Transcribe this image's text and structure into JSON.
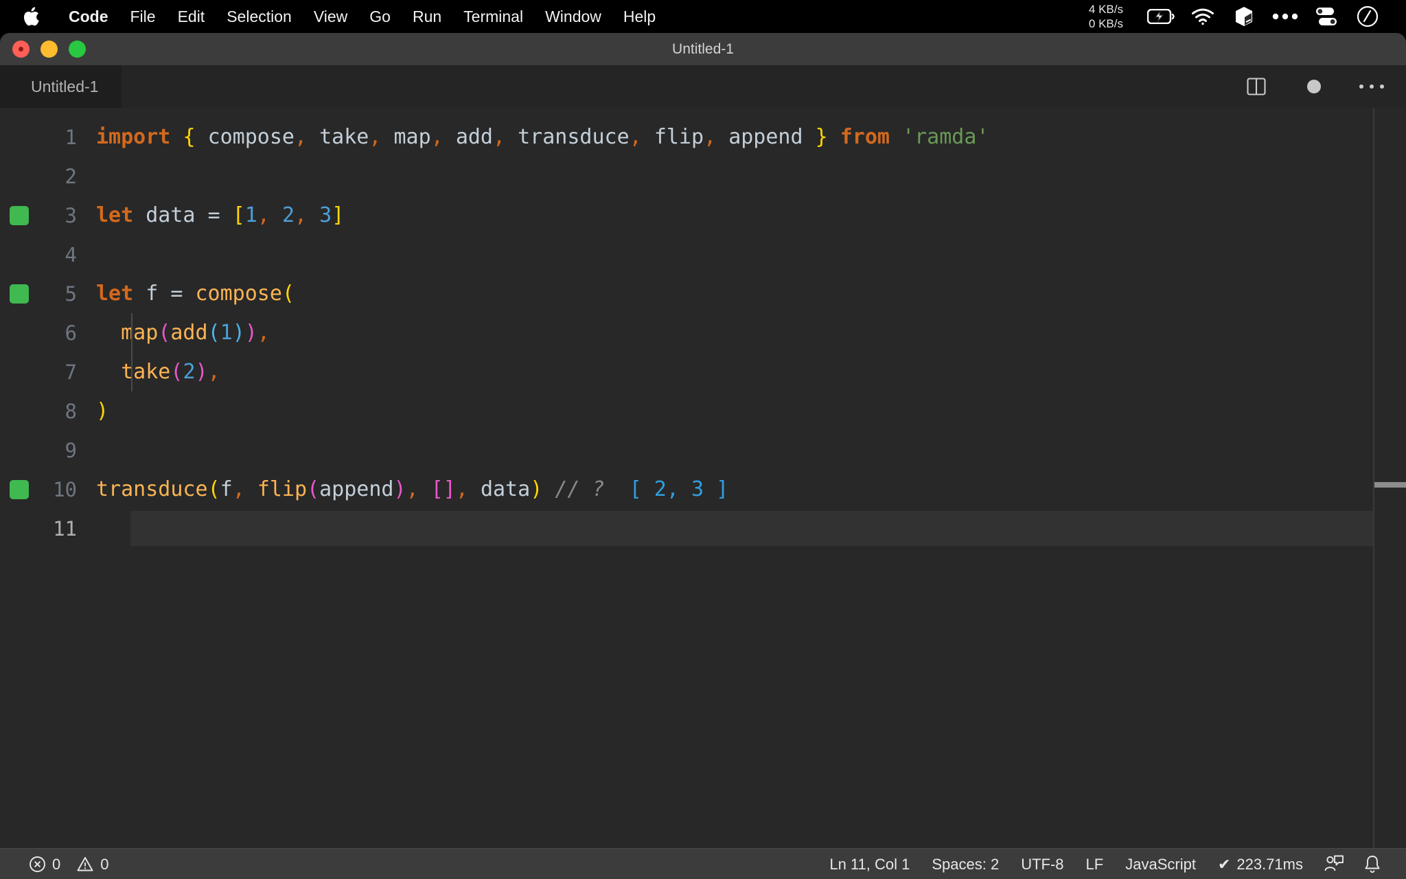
{
  "menubar": {
    "apple_icon": "apple-logo-icon",
    "items": [
      {
        "label": "Code",
        "bold": true
      },
      {
        "label": "File",
        "bold": false
      },
      {
        "label": "Edit",
        "bold": false
      },
      {
        "label": "Selection",
        "bold": false
      },
      {
        "label": "View",
        "bold": false
      },
      {
        "label": "Go",
        "bold": false
      },
      {
        "label": "Run",
        "bold": false
      },
      {
        "label": "Terminal",
        "bold": false
      },
      {
        "label": "Window",
        "bold": false
      },
      {
        "label": "Help",
        "bold": false
      }
    ],
    "network_down": "4 KB/s",
    "network_up": "0 KB/s",
    "tray_icons": [
      "battery-charging-icon",
      "wifi-icon",
      "cube-icon",
      "ellipsis-icon",
      "control-center-icon",
      "siri-clock-icon"
    ]
  },
  "window": {
    "title": "Untitled-1",
    "traffic_lights": [
      "close-button",
      "minimize-button",
      "maximize-button"
    ]
  },
  "tabs": {
    "active_tab": "Untitled-1",
    "actions": [
      "split-editor-icon",
      "unsaved-dot-icon",
      "more-actions-icon"
    ]
  },
  "editor": {
    "language": "JavaScript",
    "lines": [
      {
        "n": "1",
        "run_marker": false,
        "active": false,
        "tokens": [
          {
            "t": "import",
            "c": "t-kw"
          },
          {
            "t": " ",
            "c": "t-var"
          },
          {
            "t": "{",
            "c": "t-b1"
          },
          {
            "t": " ",
            "c": "t-var"
          },
          {
            "t": "compose",
            "c": "t-var"
          },
          {
            "t": ",",
            "c": "t-comma"
          },
          {
            "t": " ",
            "c": "t-var"
          },
          {
            "t": "take",
            "c": "t-var"
          },
          {
            "t": ",",
            "c": "t-comma"
          },
          {
            "t": " ",
            "c": "t-var"
          },
          {
            "t": "map",
            "c": "t-var"
          },
          {
            "t": ",",
            "c": "t-comma"
          },
          {
            "t": " ",
            "c": "t-var"
          },
          {
            "t": "add",
            "c": "t-var"
          },
          {
            "t": ",",
            "c": "t-comma"
          },
          {
            "t": " ",
            "c": "t-var"
          },
          {
            "t": "transduce",
            "c": "t-var"
          },
          {
            "t": ",",
            "c": "t-comma"
          },
          {
            "t": " ",
            "c": "t-var"
          },
          {
            "t": "flip",
            "c": "t-var"
          },
          {
            "t": ",",
            "c": "t-comma"
          },
          {
            "t": " ",
            "c": "t-var"
          },
          {
            "t": "append",
            "c": "t-var"
          },
          {
            "t": " ",
            "c": "t-var"
          },
          {
            "t": "}",
            "c": "t-b1"
          },
          {
            "t": " ",
            "c": "t-var"
          },
          {
            "t": "from",
            "c": "t-kw"
          },
          {
            "t": " ",
            "c": "t-var"
          },
          {
            "t": "'ramda'",
            "c": "t-str"
          }
        ]
      },
      {
        "n": "2",
        "run_marker": false,
        "active": false,
        "tokens": []
      },
      {
        "n": "3",
        "run_marker": true,
        "active": false,
        "tokens": [
          {
            "t": "let",
            "c": "t-kw"
          },
          {
            "t": " ",
            "c": "t-var"
          },
          {
            "t": "data",
            "c": "t-var"
          },
          {
            "t": " ",
            "c": "t-var"
          },
          {
            "t": "=",
            "c": "t-op"
          },
          {
            "t": " ",
            "c": "t-var"
          },
          {
            "t": "[",
            "c": "t-b1"
          },
          {
            "t": "1",
            "c": "t-num"
          },
          {
            "t": ",",
            "c": "t-comma"
          },
          {
            "t": " ",
            "c": "t-var"
          },
          {
            "t": "2",
            "c": "t-num"
          },
          {
            "t": ",",
            "c": "t-comma"
          },
          {
            "t": " ",
            "c": "t-var"
          },
          {
            "t": "3",
            "c": "t-num"
          },
          {
            "t": "]",
            "c": "t-b1"
          }
        ]
      },
      {
        "n": "4",
        "run_marker": false,
        "active": false,
        "tokens": []
      },
      {
        "n": "5",
        "run_marker": true,
        "active": false,
        "tokens": [
          {
            "t": "let",
            "c": "t-kw"
          },
          {
            "t": " ",
            "c": "t-var"
          },
          {
            "t": "f",
            "c": "t-var"
          },
          {
            "t": " ",
            "c": "t-var"
          },
          {
            "t": "=",
            "c": "t-op"
          },
          {
            "t": " ",
            "c": "t-var"
          },
          {
            "t": "compose",
            "c": "t-fn"
          },
          {
            "t": "(",
            "c": "t-b1"
          }
        ]
      },
      {
        "n": "6",
        "run_marker": false,
        "active": false,
        "tokens": [
          {
            "t": "  ",
            "c": "t-var"
          },
          {
            "t": "map",
            "c": "t-fn"
          },
          {
            "t": "(",
            "c": "t-b2"
          },
          {
            "t": "add",
            "c": "t-fn"
          },
          {
            "t": "(",
            "c": "t-b3"
          },
          {
            "t": "1",
            "c": "t-num"
          },
          {
            "t": ")",
            "c": "t-b3"
          },
          {
            "t": ")",
            "c": "t-b2"
          },
          {
            "t": ",",
            "c": "t-comma"
          }
        ]
      },
      {
        "n": "7",
        "run_marker": false,
        "active": false,
        "tokens": [
          {
            "t": "  ",
            "c": "t-var"
          },
          {
            "t": "take",
            "c": "t-fn"
          },
          {
            "t": "(",
            "c": "t-b2"
          },
          {
            "t": "2",
            "c": "t-num"
          },
          {
            "t": ")",
            "c": "t-b2"
          },
          {
            "t": ",",
            "c": "t-comma"
          }
        ]
      },
      {
        "n": "8",
        "run_marker": false,
        "active": false,
        "tokens": [
          {
            "t": ")",
            "c": "t-b1"
          }
        ]
      },
      {
        "n": "9",
        "run_marker": false,
        "active": false,
        "tokens": []
      },
      {
        "n": "10",
        "run_marker": true,
        "active": false,
        "tokens": [
          {
            "t": "transduce",
            "c": "t-fn"
          },
          {
            "t": "(",
            "c": "t-b1"
          },
          {
            "t": "f",
            "c": "t-var"
          },
          {
            "t": ",",
            "c": "t-comma"
          },
          {
            "t": " ",
            "c": "t-var"
          },
          {
            "t": "flip",
            "c": "t-fn"
          },
          {
            "t": "(",
            "c": "t-b2"
          },
          {
            "t": "append",
            "c": "t-var"
          },
          {
            "t": ")",
            "c": "t-b2"
          },
          {
            "t": ",",
            "c": "t-comma"
          },
          {
            "t": " ",
            "c": "t-var"
          },
          {
            "t": "[",
            "c": "t-b2"
          },
          {
            "t": "]",
            "c": "t-b2"
          },
          {
            "t": ",",
            "c": "t-comma"
          },
          {
            "t": " ",
            "c": "t-var"
          },
          {
            "t": "data",
            "c": "t-var"
          },
          {
            "t": ")",
            "c": "t-b1"
          },
          {
            "t": " ",
            "c": "t-var"
          },
          {
            "t": "// ?",
            "c": "t-comment"
          },
          {
            "t": "  ",
            "c": "t-var"
          },
          {
            "t": "[ 2, 3 ]",
            "c": "t-result"
          }
        ]
      },
      {
        "n": "11",
        "run_marker": false,
        "active": true,
        "tokens": []
      }
    ]
  },
  "statusbar": {
    "error_icon": "error-circle-icon",
    "error_count": "0",
    "warning_icon": "warning-triangle-icon",
    "warning_count": "0",
    "cursor_position": "Ln 11, Col 1",
    "indentation": "Spaces: 2",
    "encoding": "UTF-8",
    "eol": "LF",
    "language_mode": "JavaScript",
    "run_check": "✔",
    "run_time": "223.71ms",
    "feedback_icon": "feedback-person-icon",
    "bell_icon": "notifications-bell-icon"
  }
}
